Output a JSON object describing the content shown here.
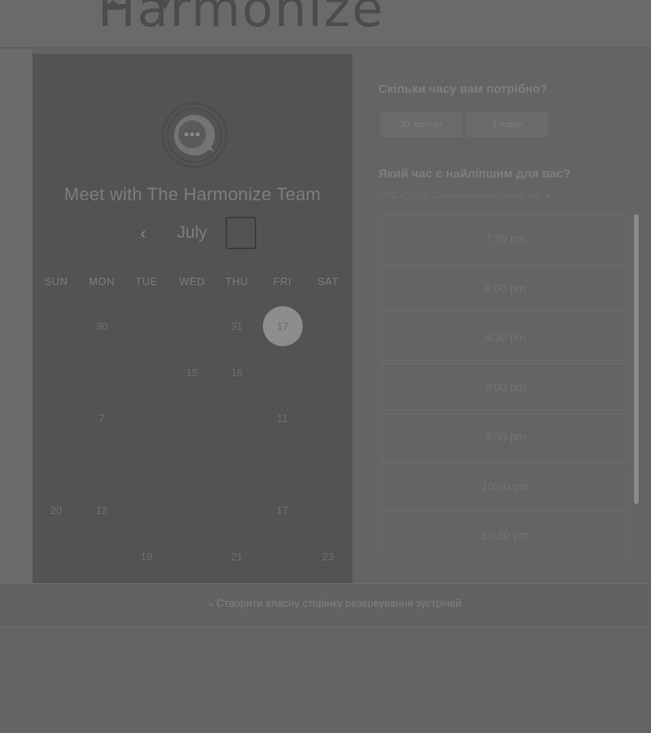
{
  "header": {
    "logo_text": "Harmonize"
  },
  "calendar": {
    "title": "Meet with The Harmonize Team",
    "month": "July",
    "prev_icon": "‹",
    "weekdays": [
      "SUN",
      "MON",
      "TUE",
      "WED",
      "THU",
      "FRI",
      "SAT"
    ],
    "days": [
      "30",
      "31",
      "15",
      "16",
      "7",
      "11",
      "20",
      "12",
      "17",
      "19",
      "21",
      "23"
    ],
    "selected_day": "17"
  },
  "duration": {
    "heading": "Скільки часу вам потрібно?",
    "options": [
      "30 хвилин",
      "1 годин"
    ]
  },
  "time": {
    "heading": "Який час є найліпшим для вас?",
    "timezone": "UTC+02:00 Східноєвропейський час",
    "slots": [
      "7:30 pm",
      "8:00 pm",
      "8:30 pm",
      "9:00 pm",
      "9:30 pm",
      "10:00 pm",
      "10:30 pm"
    ]
  },
  "footer": {
    "link_text": "Створити власну сторінку резервування зустрічей"
  },
  "colors": {
    "overlay": "#646464",
    "panel": "#535353",
    "selected_day": "#8d8d8d"
  }
}
